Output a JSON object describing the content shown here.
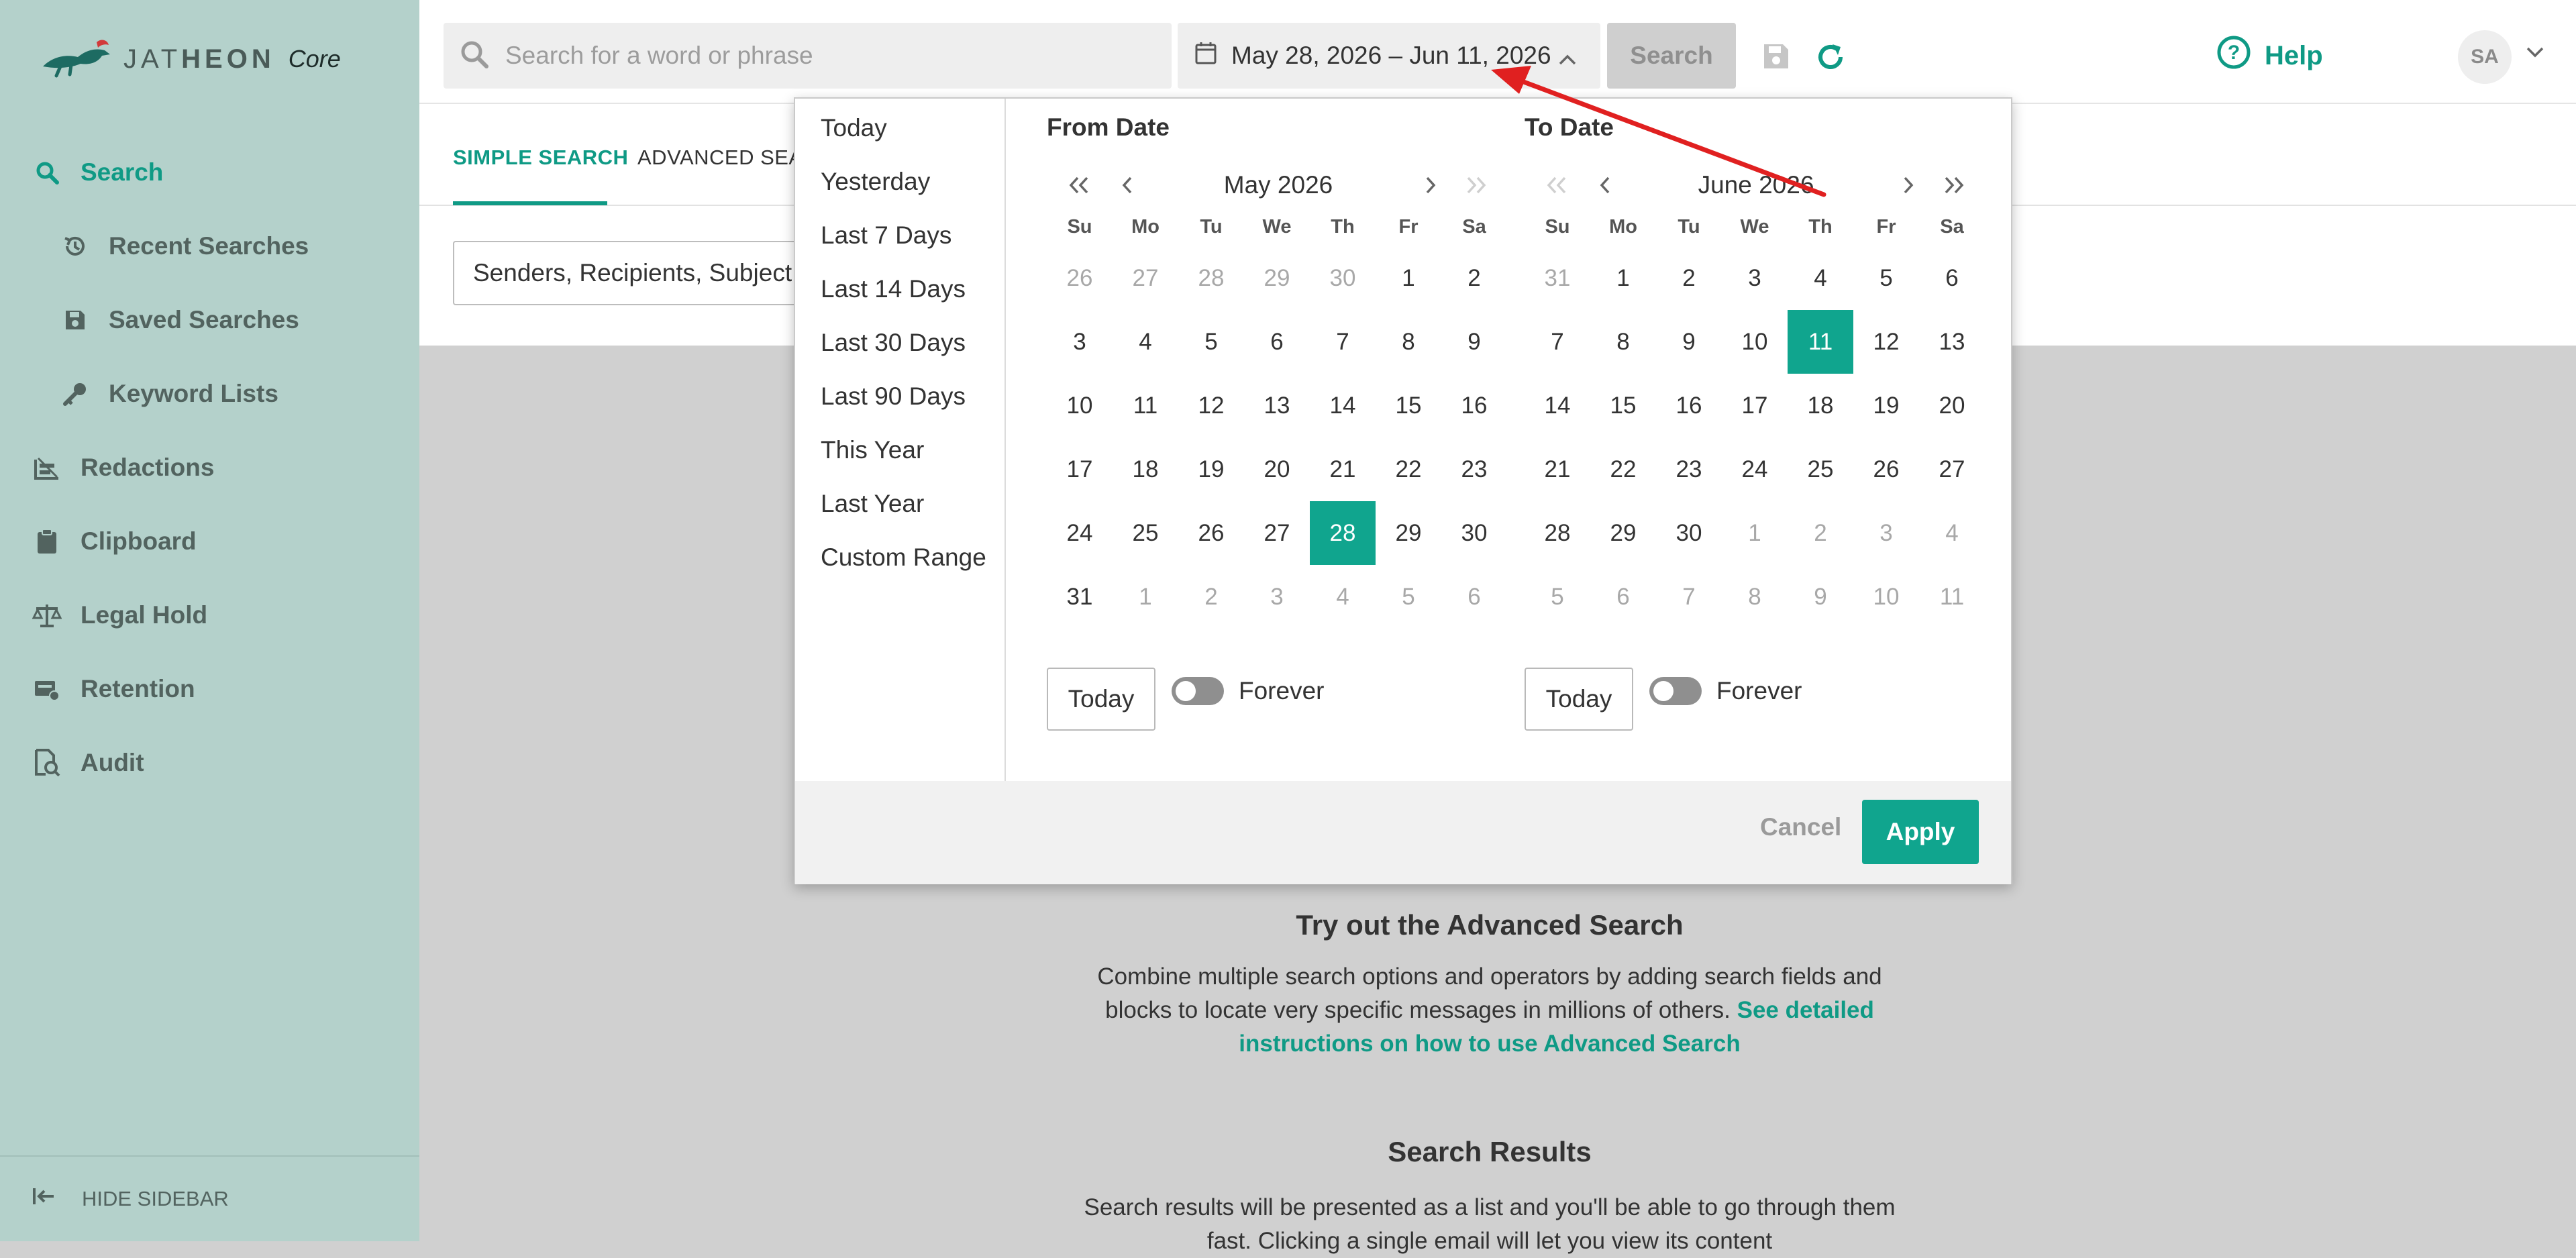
{
  "brand": {
    "wordmark_light": "JAT",
    "wordmark_bold": "HEON",
    "product": "Core"
  },
  "sidebar": {
    "items": [
      {
        "label": "Search",
        "icon": "search-icon"
      },
      {
        "label": "Recent Searches",
        "icon": "history-icon"
      },
      {
        "label": "Saved Searches",
        "icon": "save-icon"
      },
      {
        "label": "Keyword Lists",
        "icon": "key-icon"
      },
      {
        "label": "Redactions",
        "icon": "redaction-icon"
      },
      {
        "label": "Clipboard",
        "icon": "clipboard-icon"
      },
      {
        "label": "Legal Hold",
        "icon": "scale-icon"
      },
      {
        "label": "Retention",
        "icon": "retention-icon"
      },
      {
        "label": "Audit",
        "icon": "audit-icon"
      }
    ],
    "hide_label": "HIDE SIDEBAR"
  },
  "topbar": {
    "search_placeholder": "Search for a word or phrase",
    "date_range": "May 28, 2026 – Jun 11, 2026",
    "search_button": "Search",
    "help_label": "Help",
    "avatar_initials": "SA"
  },
  "tabs": {
    "simple": "SIMPLE SEARCH",
    "advanced": "ADVANCED SEAR"
  },
  "filter": {
    "text": "Senders, Recipients, Subject,.."
  },
  "info": {
    "title": "Try out the Advanced Search",
    "body": "Combine multiple search options and operators by adding search fields and blocks to locate very specific messages in millions of others.",
    "link": "See detailed instructions on how to use Advanced Search"
  },
  "results": {
    "title": "Search Results",
    "body": "Search results will be presented as a list and you'll be able to go through them fast. Clicking a single email will let you view its content"
  },
  "picker": {
    "ranges": [
      "Today",
      "Yesterday",
      "Last 7 Days",
      "Last 14 Days",
      "Last 30 Days",
      "Last 90 Days",
      "This Year",
      "Last Year",
      "Custom Range"
    ],
    "weekdays": [
      "Su",
      "Mo",
      "Tu",
      "We",
      "Th",
      "Fr",
      "Sa"
    ],
    "from": {
      "title": "From Date",
      "month": "May 2026",
      "days": [
        [
          [
            "26",
            1
          ],
          [
            "27",
            1
          ],
          [
            "28",
            1
          ],
          [
            "29",
            1
          ],
          [
            "30",
            1
          ],
          [
            "1",
            0
          ],
          [
            "2",
            0
          ]
        ],
        [
          [
            "3",
            0
          ],
          [
            "4",
            0
          ],
          [
            "5",
            0
          ],
          [
            "6",
            0
          ],
          [
            "7",
            0
          ],
          [
            "8",
            0
          ],
          [
            "9",
            0
          ]
        ],
        [
          [
            "10",
            0
          ],
          [
            "11",
            0
          ],
          [
            "12",
            0
          ],
          [
            "13",
            0
          ],
          [
            "14",
            0
          ],
          [
            "15",
            0
          ],
          [
            "16",
            0
          ]
        ],
        [
          [
            "17",
            0
          ],
          [
            "18",
            0
          ],
          [
            "19",
            0
          ],
          [
            "20",
            0
          ],
          [
            "21",
            0
          ],
          [
            "22",
            0
          ],
          [
            "23",
            0
          ]
        ],
        [
          [
            "24",
            0
          ],
          [
            "25",
            0
          ],
          [
            "26",
            0
          ],
          [
            "27",
            0
          ],
          [
            "28",
            2
          ],
          [
            "29",
            0
          ],
          [
            "30",
            0
          ]
        ],
        [
          [
            "31",
            0
          ],
          [
            "1",
            1
          ],
          [
            "2",
            1
          ],
          [
            "3",
            1
          ],
          [
            "4",
            1
          ],
          [
            "5",
            1
          ],
          [
            "6",
            1
          ]
        ]
      ],
      "today_label": "Today",
      "forever_label": "Forever"
    },
    "to": {
      "title": "To Date",
      "month": "June 2026",
      "days": [
        [
          [
            "31",
            1
          ],
          [
            "1",
            0
          ],
          [
            "2",
            0
          ],
          [
            "3",
            0
          ],
          [
            "4",
            0
          ],
          [
            "5",
            0
          ],
          [
            "6",
            0
          ]
        ],
        [
          [
            "7",
            0
          ],
          [
            "8",
            0
          ],
          [
            "9",
            0
          ],
          [
            "10",
            0
          ],
          [
            "11",
            2
          ],
          [
            "12",
            0
          ],
          [
            "13",
            0
          ]
        ],
        [
          [
            "14",
            0
          ],
          [
            "15",
            0
          ],
          [
            "16",
            0
          ],
          [
            "17",
            0
          ],
          [
            "18",
            0
          ],
          [
            "19",
            0
          ],
          [
            "20",
            0
          ]
        ],
        [
          [
            "21",
            0
          ],
          [
            "22",
            0
          ],
          [
            "23",
            0
          ],
          [
            "24",
            0
          ],
          [
            "25",
            0
          ],
          [
            "26",
            0
          ],
          [
            "27",
            0
          ]
        ],
        [
          [
            "28",
            0
          ],
          [
            "29",
            0
          ],
          [
            "30",
            0
          ],
          [
            "1",
            1
          ],
          [
            "2",
            1
          ],
          [
            "3",
            1
          ],
          [
            "4",
            1
          ]
        ],
        [
          [
            "5",
            1
          ],
          [
            "6",
            1
          ],
          [
            "7",
            1
          ],
          [
            "8",
            1
          ],
          [
            "9",
            1
          ],
          [
            "10",
            1
          ],
          [
            "11",
            1
          ]
        ]
      ],
      "today_label": "Today",
      "forever_label": "Forever"
    },
    "cancel": "Cancel",
    "apply": "Apply"
  },
  "colors": {
    "accent": "#10a58e",
    "sidebar": "#b4d1cb",
    "annotation": "#e02020"
  }
}
